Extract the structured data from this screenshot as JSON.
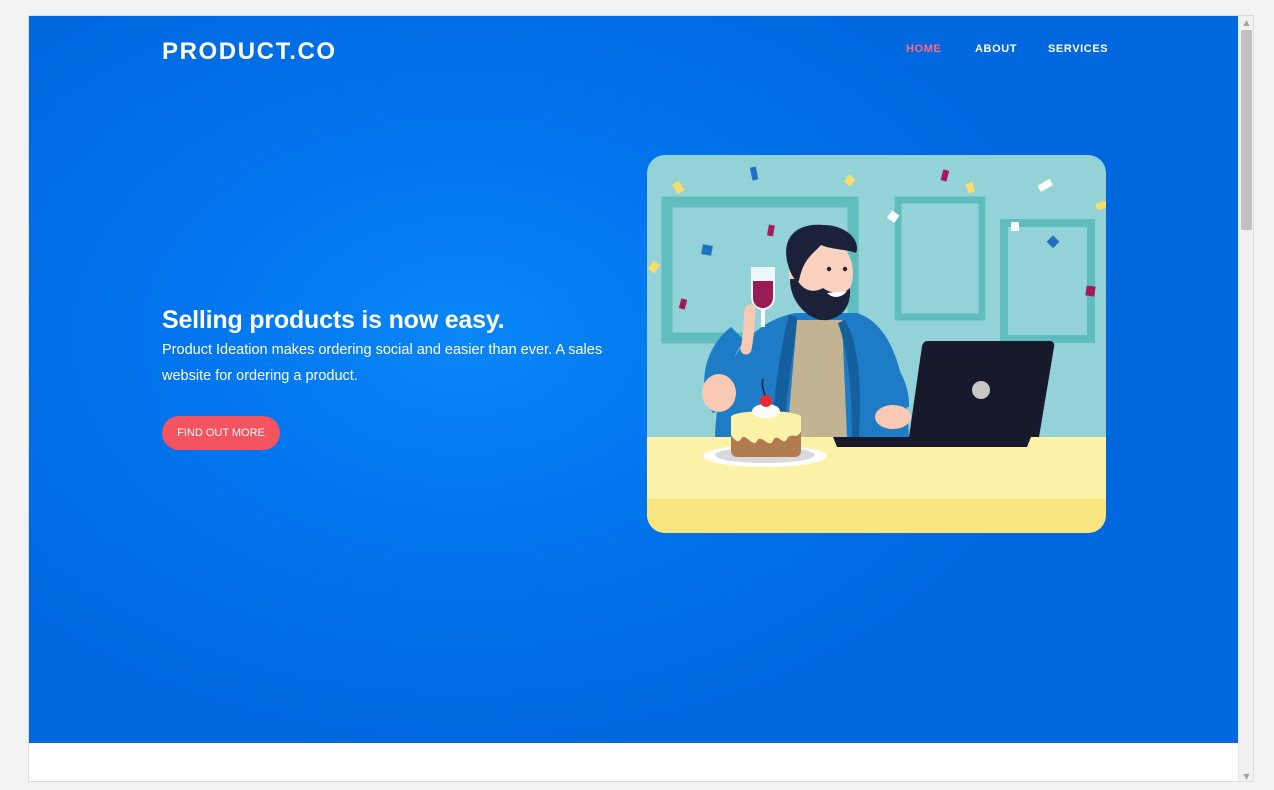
{
  "header": {
    "logo": "PRODUCT.CO",
    "nav": [
      {
        "label": "HOME",
        "active": true
      },
      {
        "label": "ABOUT",
        "active": false
      },
      {
        "label": "SERVICES",
        "active": false
      }
    ]
  },
  "hero": {
    "headline": "Selling products is now easy.",
    "subtext": "Product Ideation makes ordering social and easier than ever. A sales website for ordering a product.",
    "cta_label": "FIND OUT MORE",
    "illustration": "man-celebrating-with-cake-and-laptop"
  },
  "colors": {
    "hero_bg": "#0275ee",
    "accent": "#f4545f",
    "nav_active": "#ff6b80"
  }
}
